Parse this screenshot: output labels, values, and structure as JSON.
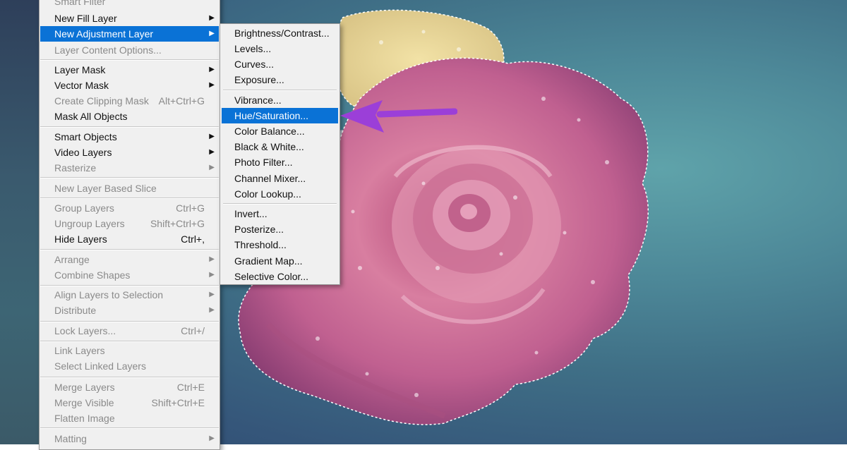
{
  "layer_menu": {
    "items": [
      {
        "label": "Smart Filter",
        "shortcut": "",
        "submenu": false,
        "disabled": true
      },
      {
        "label": "New Fill Layer",
        "shortcut": "",
        "submenu": true,
        "disabled": false
      },
      {
        "label": "New Adjustment Layer",
        "shortcut": "",
        "submenu": true,
        "disabled": false,
        "highlighted": true
      },
      {
        "label": "Layer Content Options...",
        "shortcut": "",
        "submenu": false,
        "disabled": true
      },
      {
        "label": "Layer Mask",
        "shortcut": "",
        "submenu": true,
        "disabled": false
      },
      {
        "label": "Vector Mask",
        "shortcut": "",
        "submenu": true,
        "disabled": false
      },
      {
        "label": "Create Clipping Mask",
        "shortcut": "Alt+Ctrl+G",
        "submenu": false,
        "disabled": true
      },
      {
        "label": "Mask All Objects",
        "shortcut": "",
        "submenu": false,
        "disabled": false
      },
      {
        "label": "Smart Objects",
        "shortcut": "",
        "submenu": true,
        "disabled": false
      },
      {
        "label": "Video Layers",
        "shortcut": "",
        "submenu": true,
        "disabled": false
      },
      {
        "label": "Rasterize",
        "shortcut": "",
        "submenu": true,
        "disabled": true
      },
      {
        "label": "New Layer Based Slice",
        "shortcut": "",
        "submenu": false,
        "disabled": true
      },
      {
        "label": "Group Layers",
        "shortcut": "Ctrl+G",
        "submenu": false,
        "disabled": true
      },
      {
        "label": "Ungroup Layers",
        "shortcut": "Shift+Ctrl+G",
        "submenu": false,
        "disabled": true
      },
      {
        "label": "Hide Layers",
        "shortcut": "Ctrl+,",
        "submenu": false,
        "disabled": false
      },
      {
        "label": "Arrange",
        "shortcut": "",
        "submenu": true,
        "disabled": true
      },
      {
        "label": "Combine Shapes",
        "shortcut": "",
        "submenu": true,
        "disabled": true
      },
      {
        "label": "Align Layers to Selection",
        "shortcut": "",
        "submenu": true,
        "disabled": true
      },
      {
        "label": "Distribute",
        "shortcut": "",
        "submenu": true,
        "disabled": true
      },
      {
        "label": "Lock Layers...",
        "shortcut": "Ctrl+/",
        "submenu": false,
        "disabled": true
      },
      {
        "label": "Link Layers",
        "shortcut": "",
        "submenu": false,
        "disabled": true
      },
      {
        "label": "Select Linked Layers",
        "shortcut": "",
        "submenu": false,
        "disabled": true
      },
      {
        "label": "Merge Layers",
        "shortcut": "Ctrl+E",
        "submenu": false,
        "disabled": true
      },
      {
        "label": "Merge Visible",
        "shortcut": "Shift+Ctrl+E",
        "submenu": false,
        "disabled": true
      },
      {
        "label": "Flatten Image",
        "shortcut": "",
        "submenu": false,
        "disabled": true
      },
      {
        "label": "Matting",
        "shortcut": "",
        "submenu": true,
        "disabled": true
      }
    ]
  },
  "adjustment_submenu": {
    "items": [
      {
        "label": "Brightness/Contrast...",
        "highlighted": false
      },
      {
        "label": "Levels...",
        "highlighted": false
      },
      {
        "label": "Curves...",
        "highlighted": false
      },
      {
        "label": "Exposure...",
        "highlighted": false
      },
      {
        "label": "Vibrance...",
        "highlighted": false
      },
      {
        "label": "Hue/Saturation...",
        "highlighted": true
      },
      {
        "label": "Color Balance...",
        "highlighted": false
      },
      {
        "label": "Black & White...",
        "highlighted": false
      },
      {
        "label": "Photo Filter...",
        "highlighted": false
      },
      {
        "label": "Channel Mixer...",
        "highlighted": false
      },
      {
        "label": "Color Lookup...",
        "highlighted": false
      },
      {
        "label": "Invert...",
        "highlighted": false
      },
      {
        "label": "Posterize...",
        "highlighted": false
      },
      {
        "label": "Threshold...",
        "highlighted": false
      },
      {
        "label": "Gradient Map...",
        "highlighted": false
      },
      {
        "label": "Selective Color...",
        "highlighted": false
      }
    ]
  },
  "icons": {
    "submenu_arrow": "chevron-right-icon",
    "annotation_arrow": "pointer-arrow-icon"
  },
  "colors": {
    "menu_bg": "#f0f0f0",
    "highlight": "#0a72d6",
    "annotation_arrow": "#9b3fd8"
  }
}
